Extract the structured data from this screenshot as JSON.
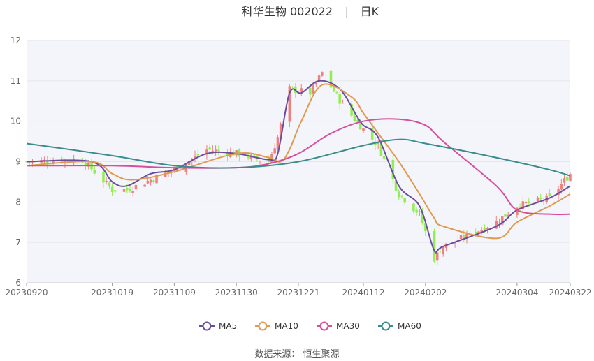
{
  "title": {
    "name": "科华生物 002022",
    "period": "日K"
  },
  "source": "数据来源：  恒生聚源",
  "legend": [
    {
      "name": "MA5",
      "color": "#6a4c9c"
    },
    {
      "name": "MA10",
      "color": "#e09a50"
    },
    {
      "name": "MA30",
      "color": "#d64f9f"
    },
    {
      "name": "MA60",
      "color": "#3a8c8c"
    }
  ],
  "colors": {
    "up": "#f08080",
    "down": "#90ee50",
    "grid": "#e6e6e6",
    "plot_band": "#f4f5fa"
  },
  "chart_data": {
    "type": "candlestick",
    "title": "科华生物 002022 日K",
    "ylim": [
      6,
      12
    ],
    "yticks": [
      6,
      7,
      8,
      9,
      10,
      11,
      12
    ],
    "xtick_labels": [
      "20230920",
      "20231019",
      "20231109",
      "20231130",
      "20231221",
      "20240112",
      "20240202",
      "20240304",
      "20240322"
    ],
    "anchors": [
      {
        "x": "20230920",
        "close": 9.0
      },
      {
        "x": "20231009",
        "close": 9.05
      },
      {
        "x": "20231019",
        "close": 8.3
      },
      {
        "x": "20231024",
        "close": 8.3
      },
      {
        "x": "20231109",
        "close": 8.8
      },
      {
        "x": "20231120",
        "close": 9.3
      },
      {
        "x": "20231130",
        "close": 9.2
      },
      {
        "x": "20231211",
        "close": 9.0
      },
      {
        "x": "20231214",
        "close": 9.6
      },
      {
        "x": "20231218",
        "close": 10.8
      },
      {
        "x": "20231225",
        "close": 10.7
      },
      {
        "x": "20231229",
        "close": 11.2
      },
      {
        "x": "20240105",
        "close": 10.4
      },
      {
        "x": "20240112",
        "close": 9.8
      },
      {
        "x": "20240117",
        "close": 9.4
      },
      {
        "x": "20240124",
        "close": 8.2
      },
      {
        "x": "20240131",
        "close": 7.7
      },
      {
        "x": "20240205",
        "close": 6.6
      },
      {
        "x": "20240208",
        "close": 6.9
      },
      {
        "x": "20240226",
        "close": 7.5
      },
      {
        "x": "20240304",
        "close": 7.9
      },
      {
        "x": "20240315",
        "close": 8.1
      },
      {
        "x": "20240322",
        "close": 8.7
      }
    ],
    "series": [
      {
        "name": "MA5",
        "points": [
          [
            "20230920",
            9.0
          ],
          [
            "20231012",
            9.0
          ],
          [
            "20231019",
            8.5
          ],
          [
            "20231024",
            8.4
          ],
          [
            "20231101",
            8.7
          ],
          [
            "20231109",
            8.8
          ],
          [
            "20231120",
            9.2
          ],
          [
            "20231130",
            9.2
          ],
          [
            "20231211",
            9.05
          ],
          [
            "20231214",
            9.2
          ],
          [
            "20231218",
            10.7
          ],
          [
            "20231222",
            10.7
          ],
          [
            "20231228",
            11.0
          ],
          [
            "20240104",
            10.8
          ],
          [
            "20240110",
            10.1
          ],
          [
            "20240112",
            9.9
          ],
          [
            "20240117",
            9.6
          ],
          [
            "20240124",
            8.4
          ],
          [
            "20240131",
            7.9
          ],
          [
            "20240205",
            6.8
          ],
          [
            "20240208",
            6.9
          ],
          [
            "20240226",
            7.4
          ],
          [
            "20240304",
            7.8
          ],
          [
            "20240315",
            8.1
          ],
          [
            "20240322",
            8.4
          ]
        ]
      },
      {
        "name": "MA10",
        "points": [
          [
            "20230920",
            8.9
          ],
          [
            "20231012",
            9.0
          ],
          [
            "20231019",
            8.7
          ],
          [
            "20231026",
            8.55
          ],
          [
            "20231109",
            8.75
          ],
          [
            "20231130",
            9.2
          ],
          [
            "20231211",
            9.1
          ],
          [
            "20231215",
            9.0
          ],
          [
            "20231218",
            9.3
          ],
          [
            "20231222",
            10.0
          ],
          [
            "20231229",
            10.9
          ],
          [
            "20240108",
            10.6
          ],
          [
            "20240112",
            10.2
          ],
          [
            "20240117",
            9.7
          ],
          [
            "20240124",
            9.0
          ],
          [
            "20240131",
            8.2
          ],
          [
            "20240205",
            7.6
          ],
          [
            "20240208",
            7.4
          ],
          [
            "20240226",
            7.1
          ],
          [
            "20240304",
            7.5
          ],
          [
            "20240315",
            7.9
          ],
          [
            "20240322",
            8.2
          ]
        ]
      },
      {
        "name": "MA30",
        "points": [
          [
            "20230920",
            8.9
          ],
          [
            "20231019",
            8.9
          ],
          [
            "20231109",
            8.85
          ],
          [
            "20231130",
            8.85
          ],
          [
            "20231211",
            8.95
          ],
          [
            "20231221",
            9.2
          ],
          [
            "20240101",
            9.7
          ],
          [
            "20240112",
            10.0
          ],
          [
            "20240124",
            10.05
          ],
          [
            "20240202",
            9.9
          ],
          [
            "20240208",
            9.5
          ],
          [
            "20240226",
            8.4
          ],
          [
            "20240304",
            7.8
          ],
          [
            "20240315",
            7.7
          ],
          [
            "20240322",
            7.7
          ]
        ]
      },
      {
        "name": "MA60",
        "points": [
          [
            "20230920",
            9.45
          ],
          [
            "20231019",
            9.15
          ],
          [
            "20231109",
            8.9
          ],
          [
            "20231130",
            8.85
          ],
          [
            "20231221",
            9.0
          ],
          [
            "20240112",
            9.4
          ],
          [
            "20240124",
            9.55
          ],
          [
            "20240202",
            9.45
          ],
          [
            "20240226",
            9.1
          ],
          [
            "20240315",
            8.8
          ],
          [
            "20240322",
            8.65
          ]
        ]
      }
    ]
  }
}
